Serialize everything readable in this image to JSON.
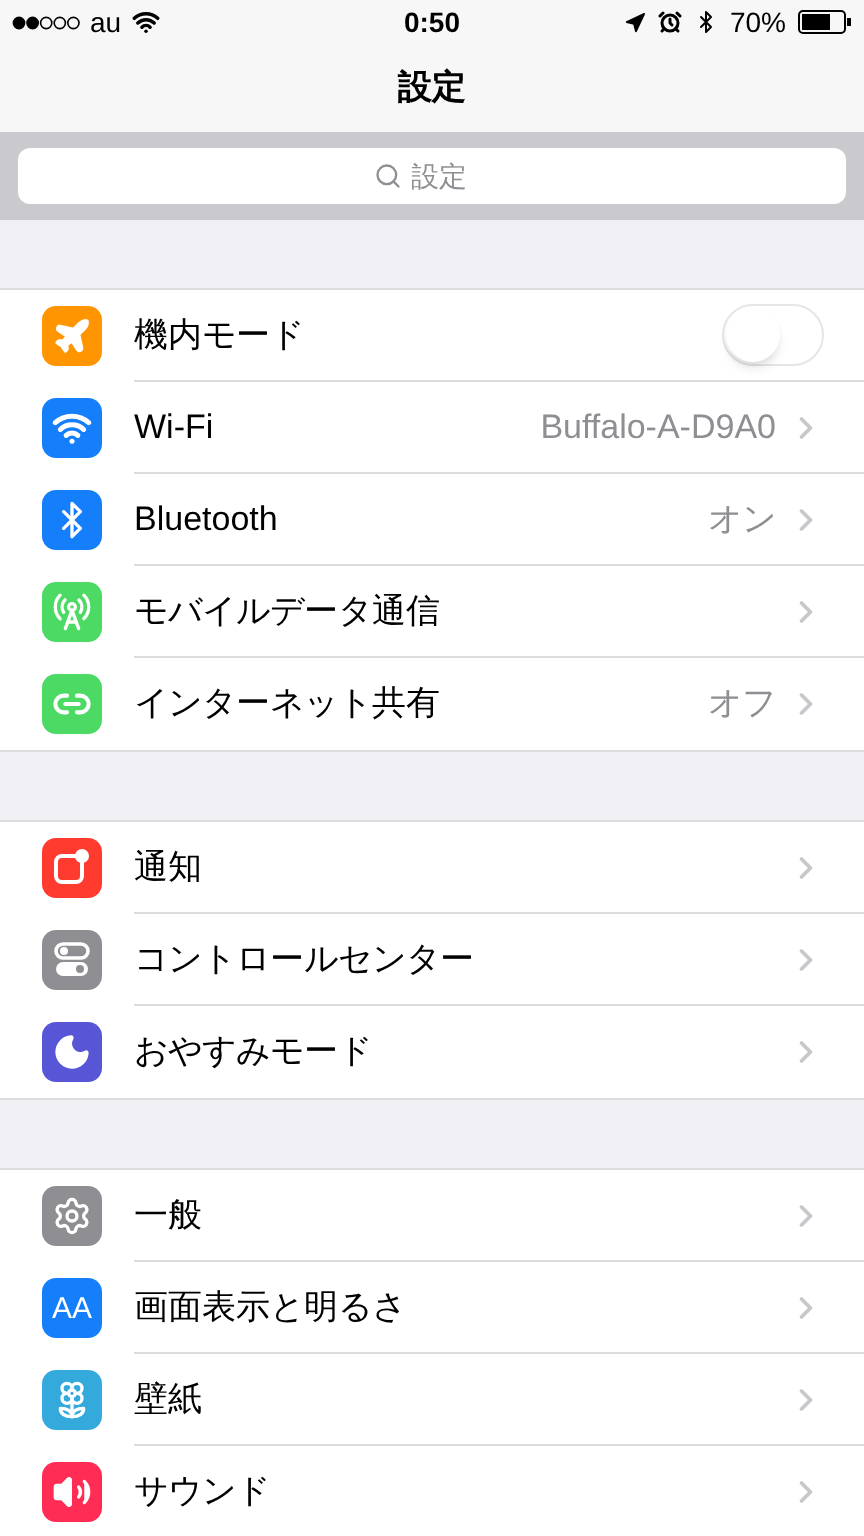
{
  "status_bar": {
    "carrier": "au",
    "time": "0:50",
    "battery": "70%"
  },
  "nav": {
    "title": "設定"
  },
  "search": {
    "placeholder": "設定"
  },
  "groups": [
    {
      "items": [
        {
          "kind": "toggle",
          "color": "#ff9500",
          "label": "機内モード",
          "on": false
        },
        {
          "kind": "link",
          "color": "#147efb",
          "label": "Wi-Fi",
          "value": "Buffalo-A-D9A0"
        },
        {
          "kind": "link",
          "color": "#147efb",
          "label": "Bluetooth",
          "value": "オン"
        },
        {
          "kind": "link",
          "color": "#4cd964",
          "label": "モバイルデータ通信"
        },
        {
          "kind": "link",
          "color": "#4cd964",
          "label": "インターネット共有",
          "value": "オフ"
        }
      ]
    },
    {
      "items": [
        {
          "kind": "link",
          "color": "#ff3b30",
          "label": "通知"
        },
        {
          "kind": "link",
          "color": "#8e8e93",
          "label": "コントロールセンター"
        },
        {
          "kind": "link",
          "color": "#5856d6",
          "label": "おやすみモード"
        }
      ]
    },
    {
      "items": [
        {
          "kind": "link",
          "color": "#8e8e93",
          "label": "一般"
        },
        {
          "kind": "link",
          "icon_label": "AA",
          "color": "#147efb",
          "label": "画面表示と明るさ"
        },
        {
          "kind": "link",
          "color": "#34aadc",
          "label": "壁紙"
        },
        {
          "kind": "link",
          "color": "#ff2d55",
          "label": "サウンド"
        }
      ]
    }
  ]
}
